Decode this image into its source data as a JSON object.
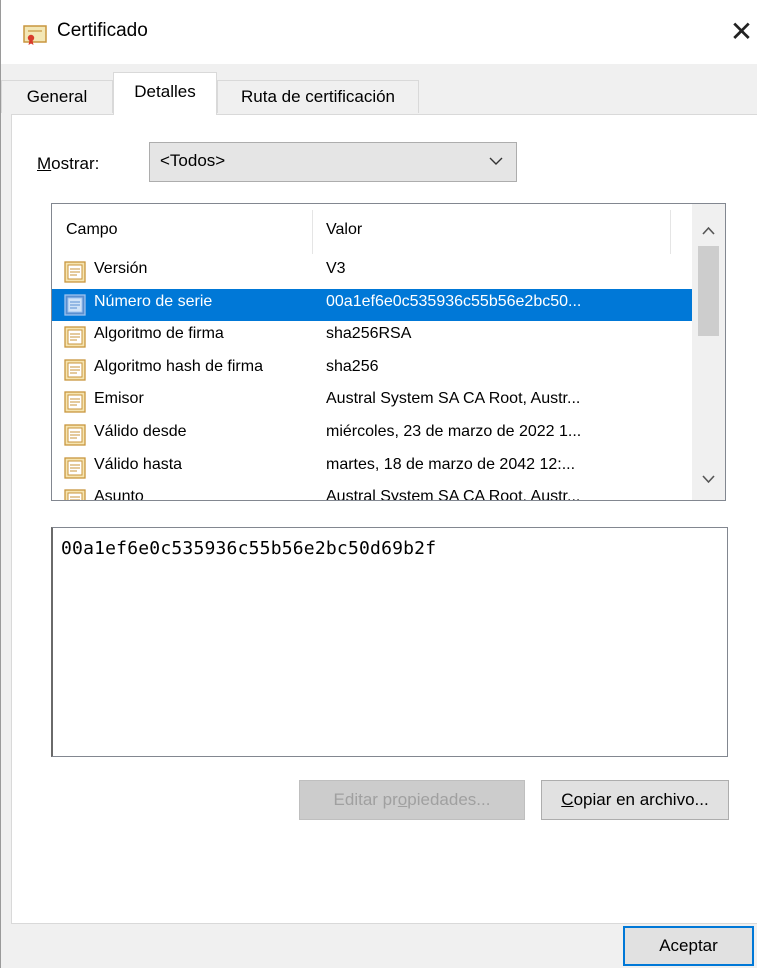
{
  "window": {
    "title": "Certificado",
    "close_glyph": "✕"
  },
  "tabs": [
    {
      "label": "General",
      "active": false
    },
    {
      "label": "Detalles",
      "active": true
    },
    {
      "label": "Ruta de certificación",
      "active": false
    }
  ],
  "show": {
    "label_mnemonic": "M",
    "label_rest": "ostrar:",
    "selected": "<Todos>"
  },
  "list": {
    "columns": [
      "Campo",
      "Valor"
    ],
    "rows": [
      {
        "field": "Versión",
        "value": "V3",
        "selected": false
      },
      {
        "field": "Número de serie",
        "value": "00a1ef6e0c535936c55b56e2bc50...",
        "selected": true
      },
      {
        "field": "Algoritmo de firma",
        "value": "sha256RSA",
        "selected": false
      },
      {
        "field": "Algoritmo hash de firma",
        "value": "sha256",
        "selected": false
      },
      {
        "field": "Emisor",
        "value": "Austral System SA CA Root, Austr...",
        "selected": false
      },
      {
        "field": "Válido desde",
        "value": "miércoles, 23 de marzo de 2022 1...",
        "selected": false
      },
      {
        "field": "Válido hasta",
        "value": "martes, 18 de marzo de 2042 12:...",
        "selected": false
      },
      {
        "field": "Asunto",
        "value": "Austral System SA CA Root, Austr...",
        "selected": false
      }
    ]
  },
  "detail": {
    "value": "00a1ef6e0c535936c55b56e2bc50d69b2f"
  },
  "buttons": {
    "edit_before": "Editar pr",
    "edit_mnemonic": "o",
    "edit_after": "piedades...",
    "copy_mnemonic": "C",
    "copy_after": "opiar en archivo...",
    "ok": "Aceptar"
  },
  "colors": {
    "selection": "#0078d7",
    "window_bg": "#f0f0f0",
    "icon": "#c8963e"
  }
}
